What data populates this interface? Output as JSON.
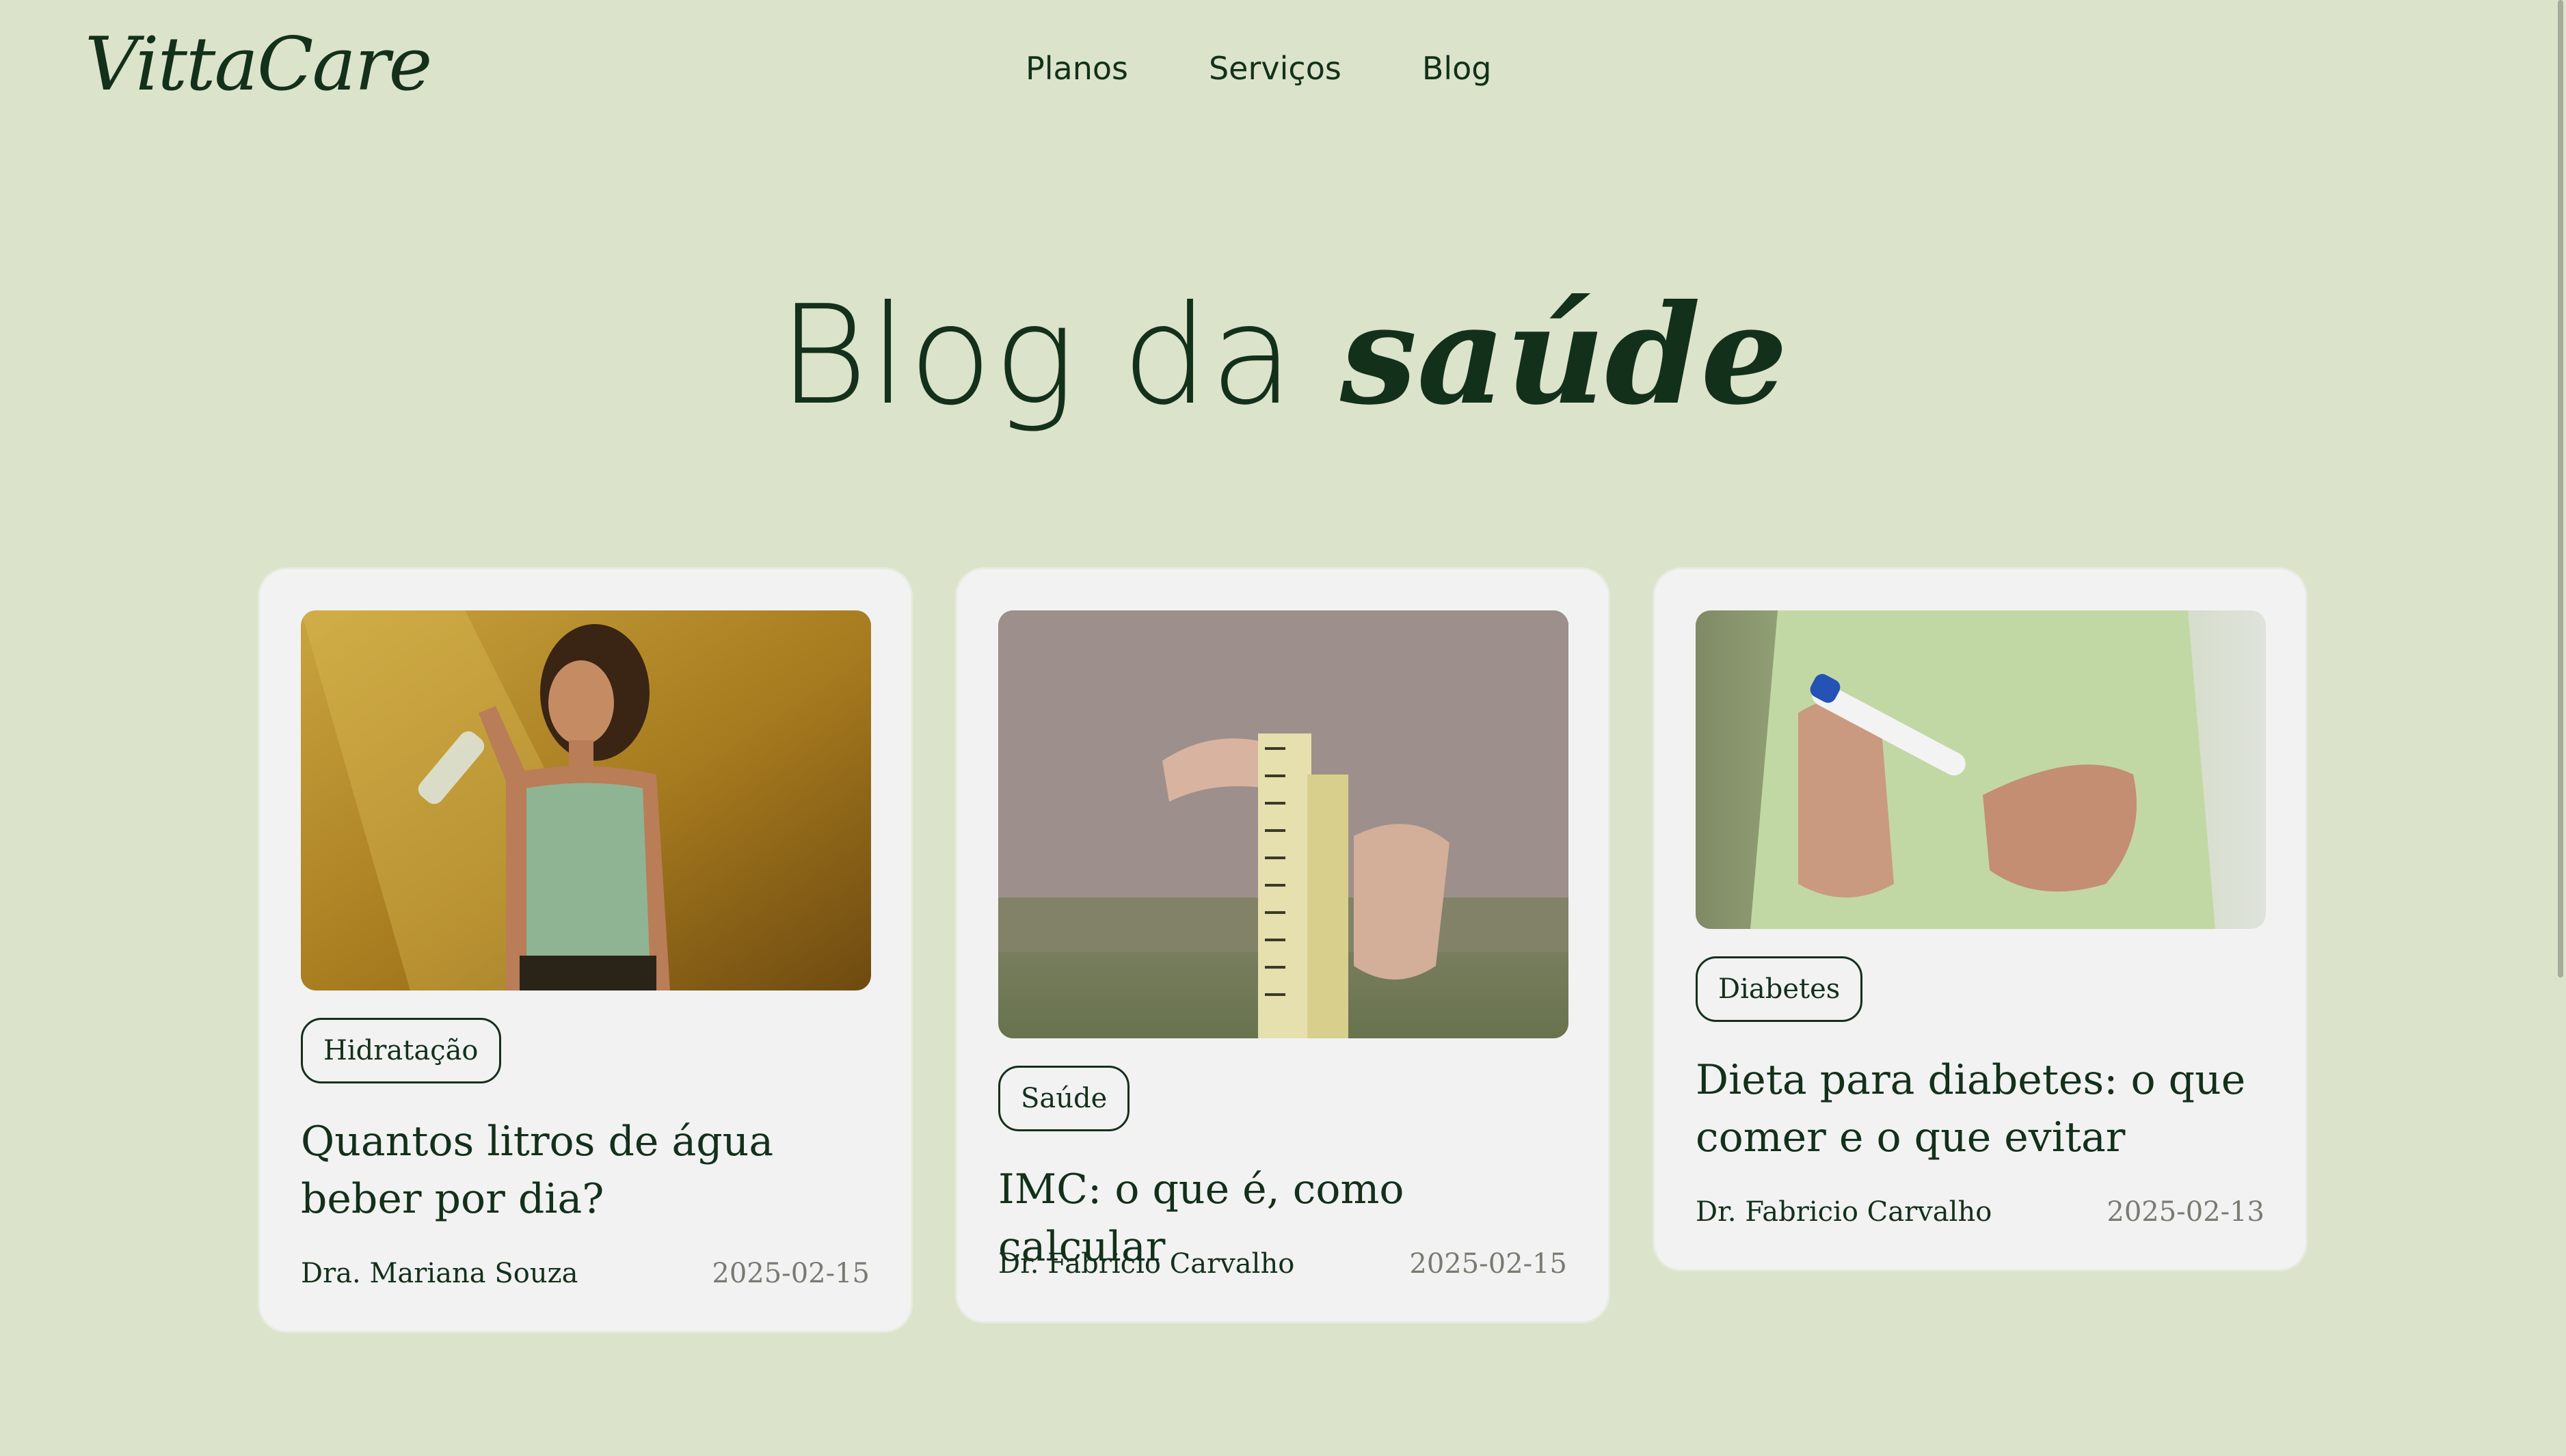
{
  "header": {
    "logo": "VittaCare",
    "nav": [
      "Planos",
      "Serviços",
      "Blog"
    ]
  },
  "hero": {
    "title_light": "Blog da ",
    "title_emphasis": "saúde"
  },
  "posts": [
    {
      "image_icon": "woman-drinking-water-photo",
      "tag": "Hidratação",
      "title": "Quantos litros de água beber por dia?",
      "author": "Dra. Mariana Souza",
      "date": "2025-02-15"
    },
    {
      "image_icon": "measuring-tape-photo",
      "tag": "Saúde",
      "title": "IMC: o que é, como calcular",
      "author": "Dr. Fabricio Carvalho",
      "date": "2025-02-15"
    },
    {
      "image_icon": "glucose-lancet-photo",
      "tag": "Diabetes",
      "title": "Dieta para diabetes: o que comer e o que evitar",
      "author": "Dr. Fabricio Carvalho",
      "date": "2025-02-13"
    }
  ],
  "colors": {
    "background": "#dbe3ca",
    "card": "#f2f2f2",
    "primary_text": "#13301a",
    "date_text": "#7a7a72"
  }
}
